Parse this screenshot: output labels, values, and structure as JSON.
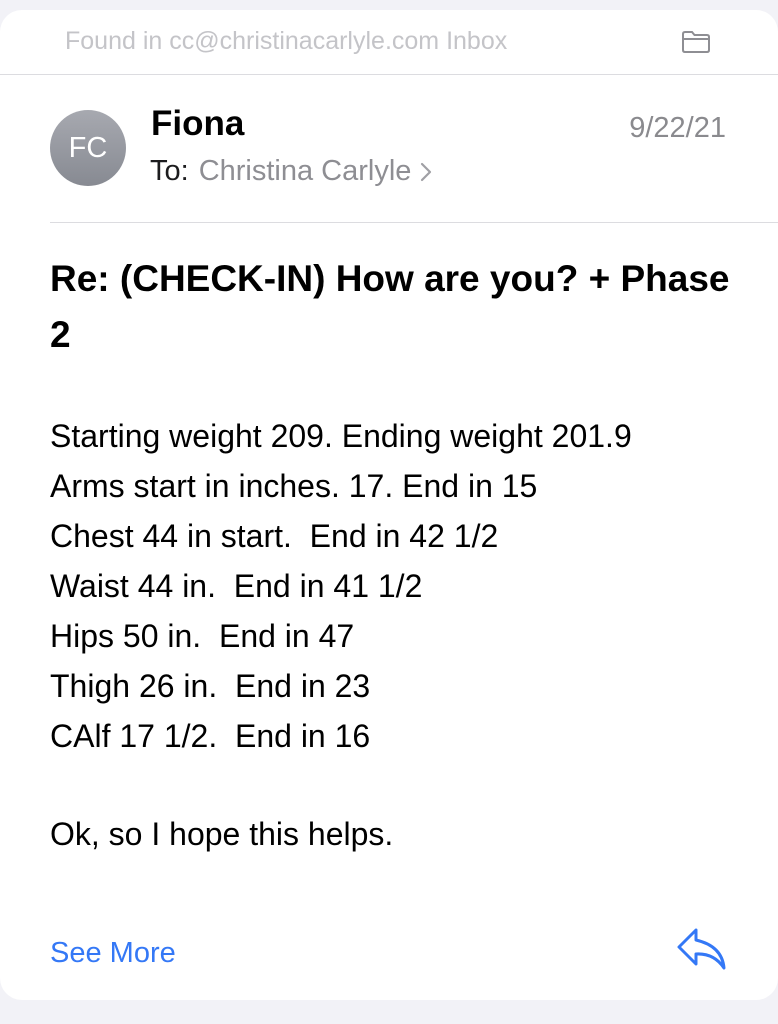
{
  "found_bar": {
    "text": "Found in cc@christinacarlyle.com Inbox",
    "icon": "folder-icon"
  },
  "message": {
    "avatar_initials": "FC",
    "sender": "Fiona",
    "date": "9/22/21",
    "to_label": "To:",
    "recipient": "Christina Carlyle",
    "subject": "Re: (CHECK-IN) How are you? + Phase 2",
    "body_lines": [
      "Starting weight 209. Ending weight 201.9",
      "Arms start in inches. 17. End in 15",
      "Chest 44 in start.  End in 42 1/2",
      "Waist 44 in.  End in 41 1/2",
      "Hips 50 in.  End in 47",
      "Thigh 26 in.  End in 23",
      "CAlf 17 1/2.  End in 16"
    ],
    "closing": "Ok, so I hope this helps."
  },
  "footer": {
    "see_more_label": "See More",
    "reply_icon": "reply-icon"
  },
  "colors": {
    "accent": "#3478f6",
    "secondary_text": "#8e8e93"
  }
}
